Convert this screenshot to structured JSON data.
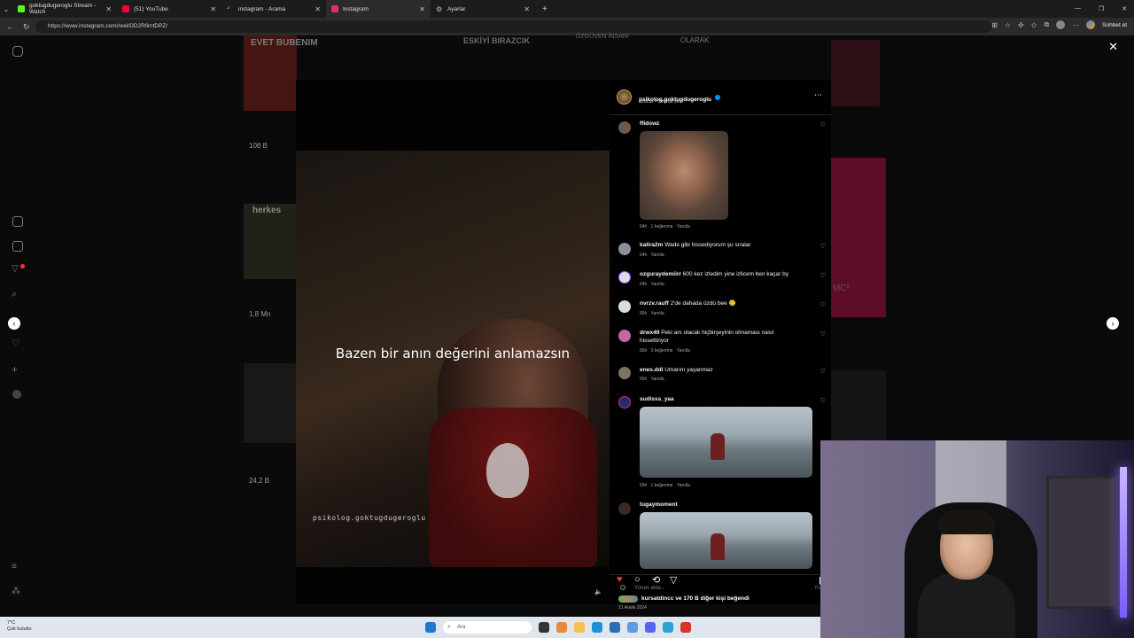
{
  "browser": {
    "tabs": [
      {
        "label": "goktugdugeroglu Stream - Watch",
        "color": "#53fc18"
      },
      {
        "label": "(51) YouTube",
        "color": "#ff0033"
      },
      {
        "label": "instagram - Arama",
        "color": "#5b8def"
      },
      {
        "label": "Instagram",
        "color": "#e1306c",
        "active": true
      },
      {
        "label": "Ayarlar",
        "color": "#aaaaaa"
      }
    ],
    "url": "https://www.instagram.com/reel/DD2RfimtDPZ/",
    "sohbet_label": "Sohbet et"
  },
  "background_tiles": {
    "labels": [
      "EVET BUBENIM",
      "ESKİYİ BIRAZCIK",
      "ÖZGÜVEN İNSANI",
      "OLARAK",
      "herkes",
      "MC²"
    ],
    "counts": [
      "108 B",
      "1,8 Mn",
      "24,2 B"
    ]
  },
  "reel": {
    "caption": "Bazen bir anın değerini anlamazsın",
    "watermark": "psikolog.goktugdugeroglu"
  },
  "post": {
    "username": "psikolog.goktugdugeroglu",
    "audio": "ozdcar • Orijinal ses",
    "comments": [
      {
        "user": "ffidowz",
        "text": "",
        "time": "64h",
        "likes": "1 beğenme",
        "reply": "Yanıtla",
        "image": "ryan"
      },
      {
        "user": "kalira2m",
        "text": "Wade gibi hissediyorum şu sıralar",
        "time": "64h",
        "likes": "",
        "reply": "Yanıtla"
      },
      {
        "user": "ozguraydemiirr",
        "text": "600 kez izledim yine izlicem ben kaçar by",
        "time": "64h",
        "likes": "",
        "reply": "Yanıtla"
      },
      {
        "user": "nvrzv.rauff",
        "text": "2'de dahada üzdü bee 🥲",
        "time": "65h",
        "likes": "",
        "reply": "Yanıtla"
      },
      {
        "user": "drwx49",
        "text": "Peki anı olacak hiçbirşeyinin olmaması nasıl hissettiriyor",
        "time": "65h",
        "likes": "3 beğenme",
        "reply": "Yanıtla"
      },
      {
        "user": "enes.ddl",
        "text": "Umarım yaşanmaz",
        "time": "65h",
        "likes": "",
        "reply": "Yanıtla"
      },
      {
        "user": "sudisss_yaa",
        "text": "",
        "time": "65h",
        "likes": "1 beğenme",
        "reply": "Yanıtla",
        "image": "deadpool"
      },
      {
        "user": "tugaymoment",
        "text": "",
        "time": "",
        "likes": "",
        "reply": "",
        "image": "deadpool"
      }
    ],
    "liked_by": "kursatdincc ve 170 B diğer kişi beğendi",
    "date": "21 Aralık 2024",
    "comment_placeholder": "Yorum ekle...",
    "post_label": "Paylaş"
  },
  "taskbar": {
    "weather_temp": "7°C",
    "weather_desc": "Çok bulutlu",
    "search_placeholder": "Ara"
  }
}
